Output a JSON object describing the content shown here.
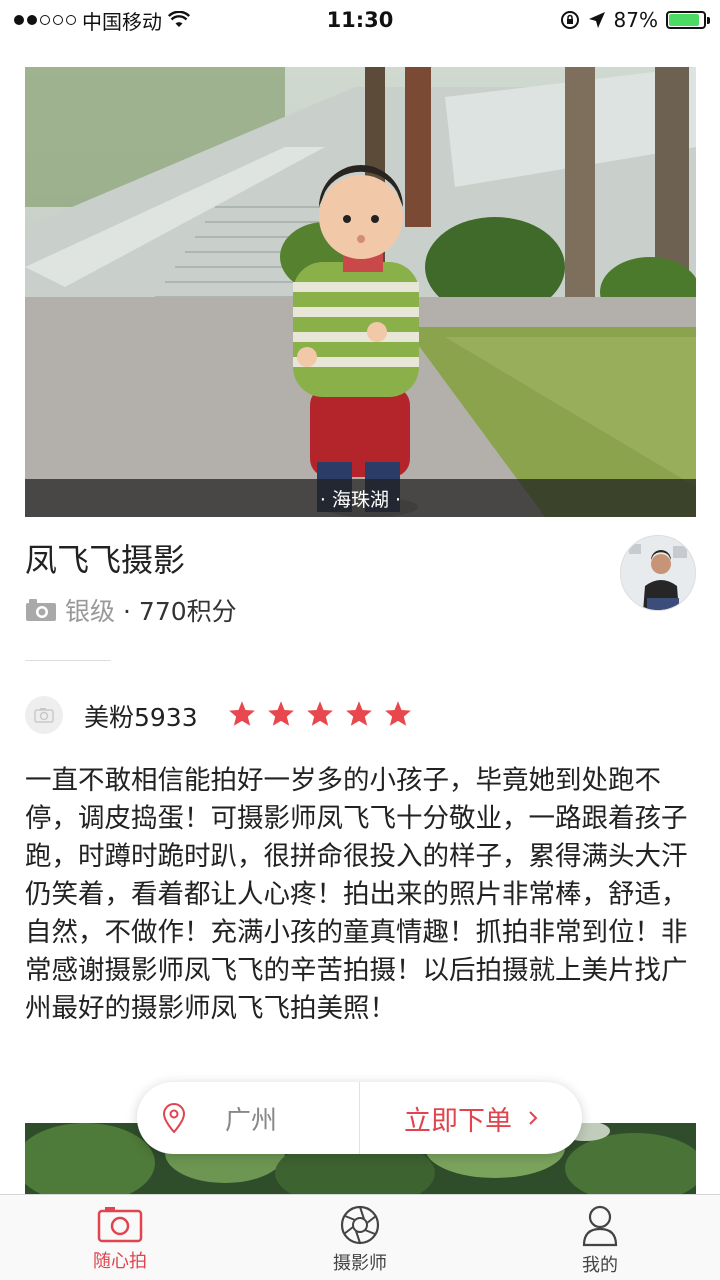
{
  "status_bar": {
    "carrier": "中国移动",
    "time": "11:30",
    "battery_percent": "87%",
    "battery_level": 0.87,
    "signal_bars_filled": 2
  },
  "hero": {
    "caption": "· 海珠湖 ·"
  },
  "photographer": {
    "name": "凤飞飞摄影",
    "level": "银级",
    "points": "· 770积分"
  },
  "review": {
    "username": "美粉5933",
    "rating": 5,
    "text": "一直不敢相信能拍好一岁多的小孩子，毕竟她到处跑不停，调皮捣蛋！可摄影师凤飞飞十分敬业，一路跟着孩子跑，时蹲时跪时趴，很拼命很投入的样子，累得满头大汗仍笑着，看着都让人心疼！拍出来的照片非常棒，舒适，自然，不做作！充满小孩的童真情趣！抓拍非常到位！非常感谢摄影师凤飞飞的辛苦拍摄！以后拍摄就上美片找广州最好的摄影师凤飞飞拍美照！"
  },
  "float_bar": {
    "city": "广州",
    "order_label": "立即下单"
  },
  "tabs": [
    {
      "label": "随心拍",
      "icon": "camera-icon",
      "active": true
    },
    {
      "label": "摄影师",
      "icon": "aperture-icon",
      "active": false
    },
    {
      "label": "我的",
      "icon": "person-icon",
      "active": false
    }
  ],
  "colors": {
    "accent": "#e0454f",
    "star": "#e8474d"
  }
}
